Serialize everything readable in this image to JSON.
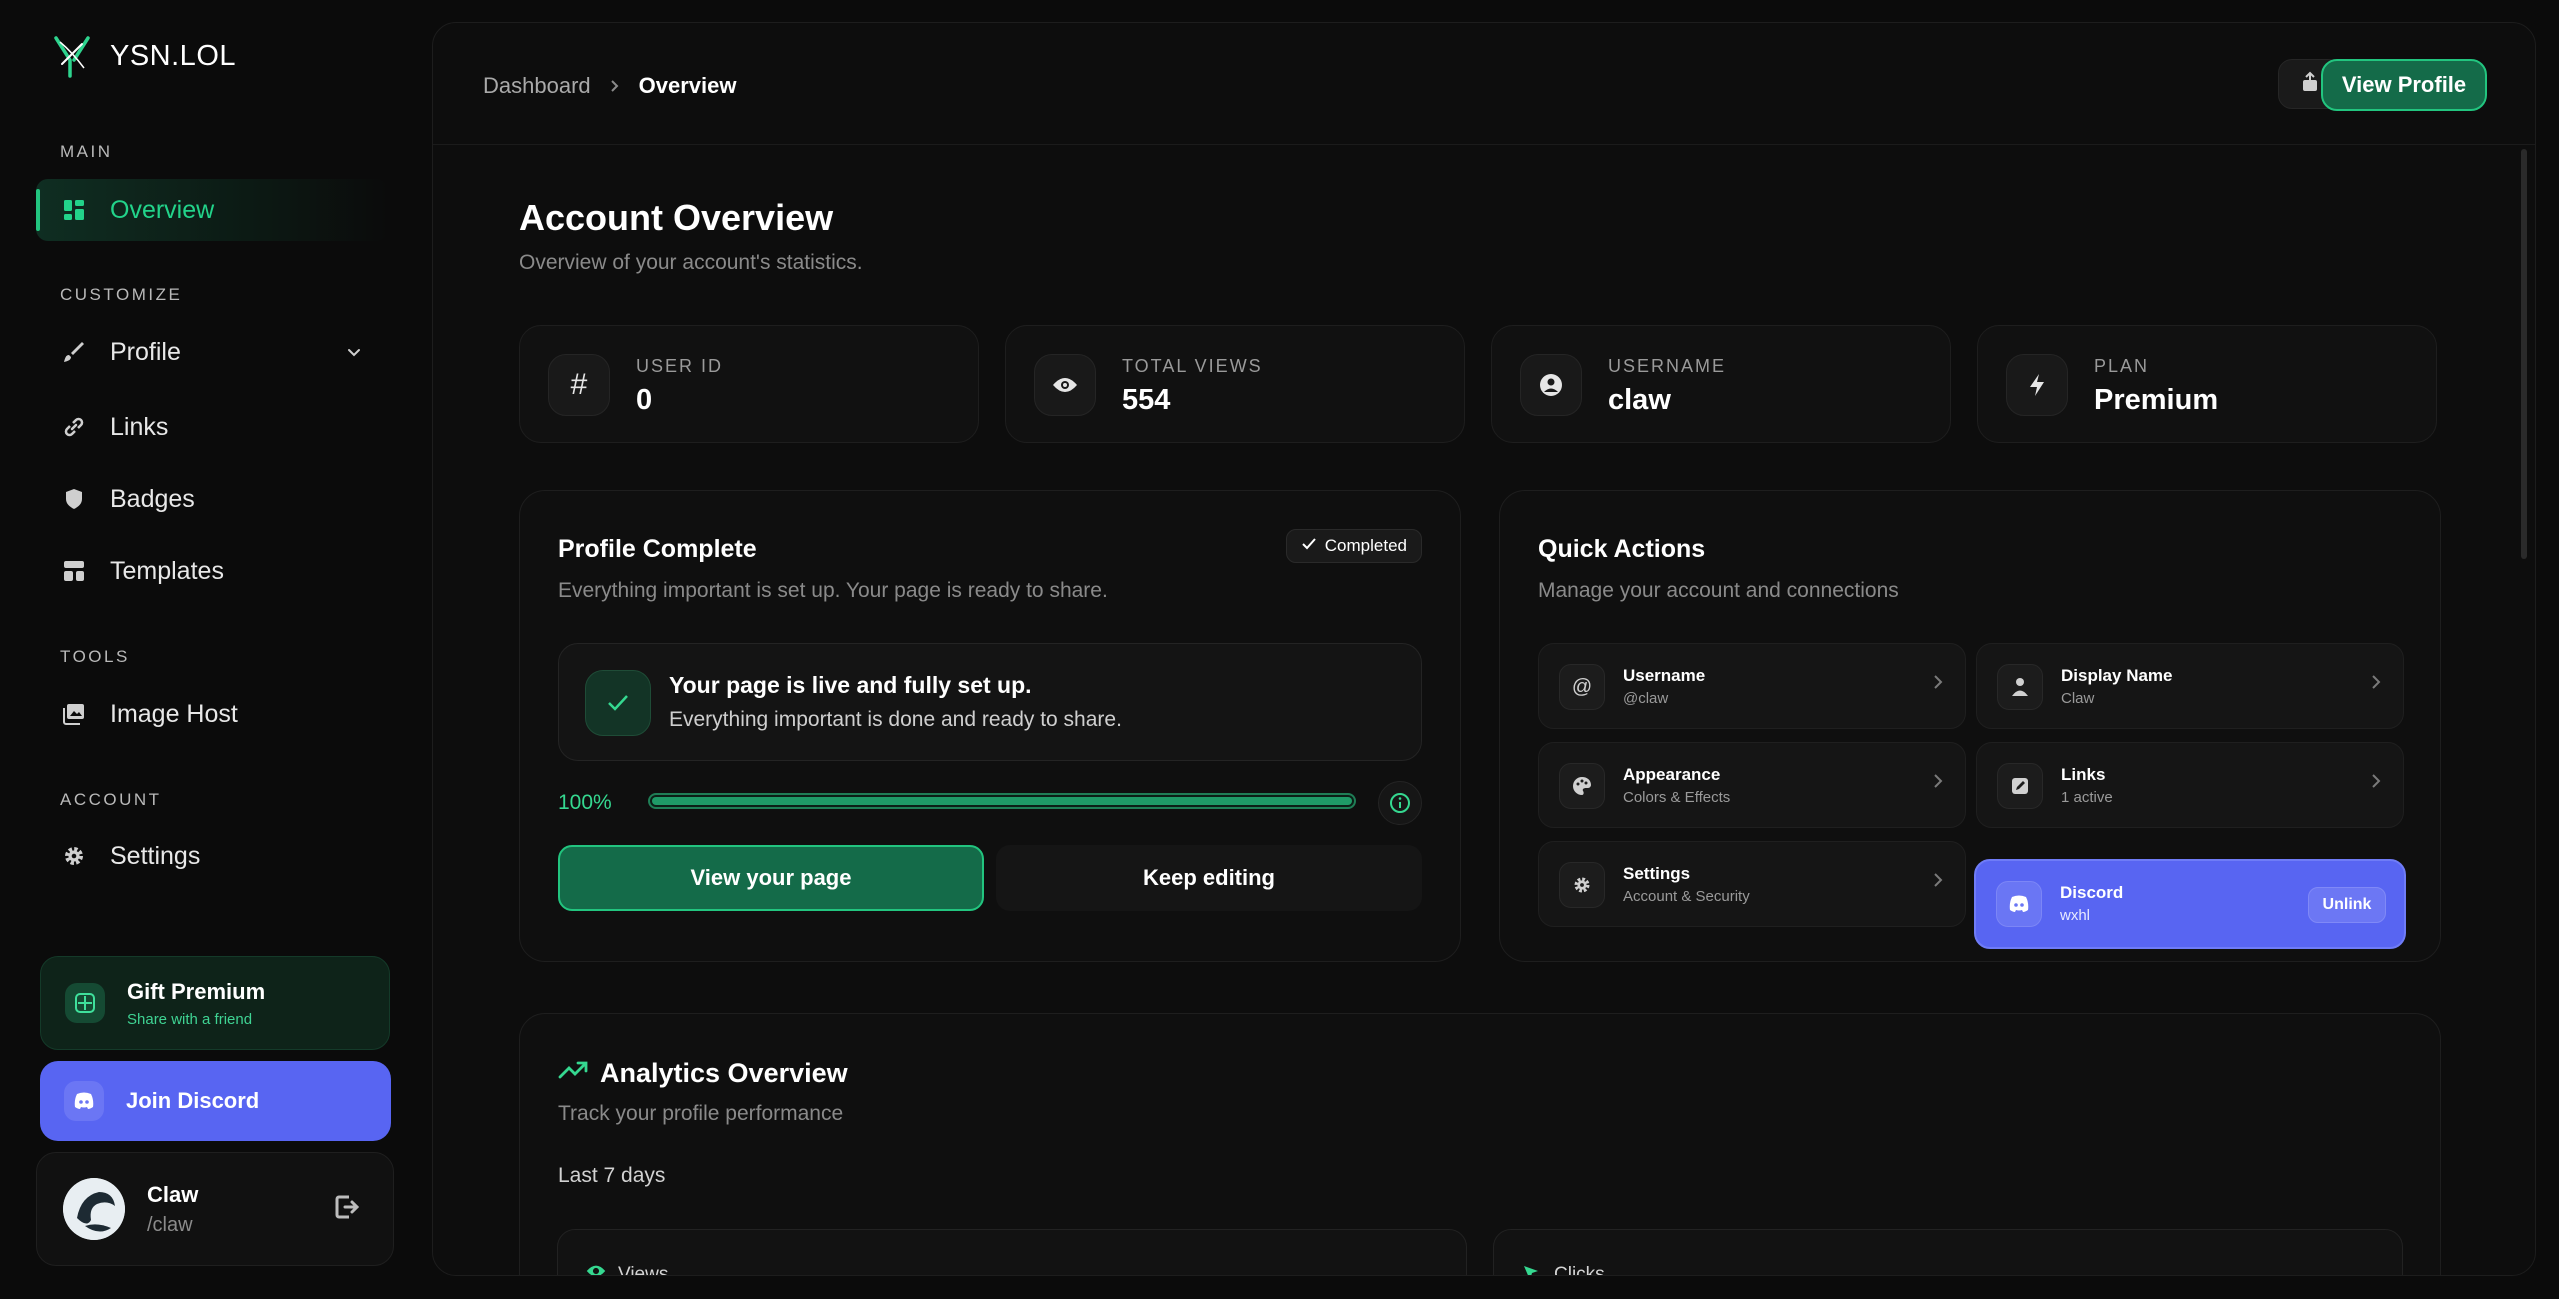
{
  "brand": {
    "name": "YSN.LOL"
  },
  "sidebar": {
    "sections": {
      "main": "MAIN",
      "customize": "CUSTOMIZE",
      "tools": "TOOLS",
      "account": "ACCOUNT"
    },
    "items": [
      {
        "label": "Overview",
        "icon": "grid-icon",
        "active": true
      },
      {
        "label": "Profile",
        "icon": "brush-icon"
      },
      {
        "label": "Links",
        "icon": "link-icon"
      },
      {
        "label": "Badges",
        "icon": "badge-icon"
      },
      {
        "label": "Templates",
        "icon": "template-icon"
      },
      {
        "label": "Image Host",
        "icon": "image-icon"
      },
      {
        "label": "Settings",
        "icon": "gear-icon"
      }
    ],
    "gift": {
      "title": "Gift Premium",
      "subtitle": "Share with a friend"
    },
    "join_discord": "Join Discord",
    "user": {
      "name": "Claw",
      "handle": "/claw"
    }
  },
  "header": {
    "breadcrumb": [
      "Dashboard",
      "Overview"
    ],
    "view_profile": "View Profile"
  },
  "page": {
    "title": "Account Overview",
    "subtitle": "Overview of your account's statistics."
  },
  "stats": [
    {
      "label": "USER ID",
      "value": "0",
      "icon": "hash-icon"
    },
    {
      "label": "TOTAL VIEWS",
      "value": "554",
      "icon": "eye-icon"
    },
    {
      "label": "USERNAME",
      "value": "claw",
      "icon": "user-circle-icon"
    },
    {
      "label": "PLAN",
      "value": "Premium",
      "icon": "bolt-icon"
    }
  ],
  "profile_complete": {
    "title": "Profile Complete",
    "badge": "Completed",
    "subtitle": "Everything important is set up. Your page is ready to share.",
    "live_title": "Your page is live and fully set up.",
    "live_text": "Everything important is done and ready to share.",
    "percent_label": "100%",
    "percent": 100,
    "view_button": "View your page",
    "edit_button": "Keep editing"
  },
  "quick_actions": {
    "title": "Quick Actions",
    "subtitle": "Manage your account and connections",
    "items": [
      {
        "title": "Username",
        "sub": "@claw",
        "icon": "at-icon"
      },
      {
        "title": "Display Name",
        "sub": "Claw",
        "icon": "person-icon"
      },
      {
        "title": "Appearance",
        "sub": "Colors & Effects",
        "icon": "palette-icon"
      },
      {
        "title": "Links",
        "sub": "1 active",
        "icon": "edit-icon"
      },
      {
        "title": "Settings",
        "sub": "Account & Security",
        "icon": "gear-icon"
      },
      {
        "title": "Discord",
        "sub": "wxhl",
        "icon": "discord-icon",
        "action": "Unlink"
      }
    ]
  },
  "analytics": {
    "title": "Analytics Overview",
    "subtitle": "Track your profile performance",
    "range": "Last 7 days",
    "views_label": "Views",
    "clicks_label": "Clicks"
  },
  "colors": {
    "accent": "#22c57f",
    "discord": "#5865f2",
    "background": "#0b0b0b"
  }
}
